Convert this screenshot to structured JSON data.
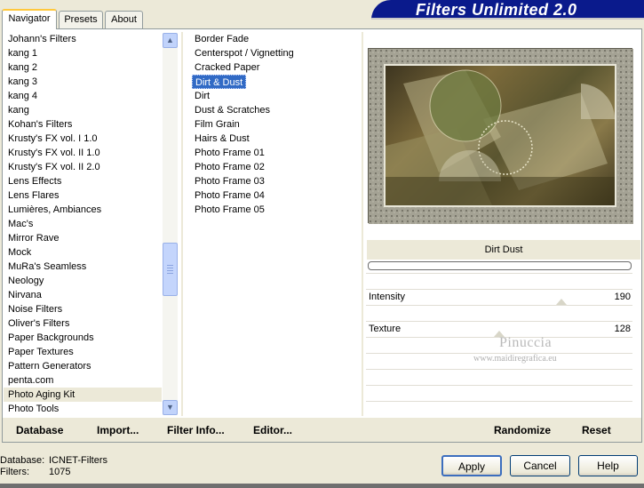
{
  "tabs": [
    {
      "label": "Navigator",
      "active": true
    },
    {
      "label": "Presets",
      "active": false
    },
    {
      "label": "About",
      "active": false
    }
  ],
  "banner": {
    "title": "Filters Unlimited 2.0"
  },
  "categories": [
    "Johann's Filters",
    "kang 1",
    "kang 2",
    "kang 3",
    "kang 4",
    "kang",
    "Kohan's Filters",
    "Krusty's FX vol. I 1.0",
    "Krusty's FX vol. II 1.0",
    "Krusty's FX vol. II 2.0",
    "Lens Effects",
    "Lens Flares",
    "Lumières, Ambiances",
    "Mac's",
    "Mirror Rave",
    "Mock",
    "MuRa's Seamless",
    "Neology",
    "Nirvana",
    "Noise Filters",
    "Oliver's Filters",
    "Paper Backgrounds",
    "Paper Textures",
    "Pattern Generators",
    "penta.com",
    "Photo Aging Kit",
    "Photo Tools"
  ],
  "highlighted_category": "Photo Aging Kit",
  "filters": [
    "Border Fade",
    "Centerspot / Vignetting",
    "Cracked Paper",
    "Dirt & Dust",
    "Dirt",
    "Dust & Scratches",
    "Film Grain",
    "Hairs & Dust",
    "Photo Frame 01",
    "Photo Frame 02",
    "Photo Frame 03",
    "Photo Frame 04",
    "Photo Frame 05"
  ],
  "selected_filter": "Dirt & Dust",
  "filter_title": "Dirt  Dust",
  "params": {
    "intensity": {
      "label": "Intensity",
      "value": "190"
    },
    "texture": {
      "label": "Texture",
      "value": "128"
    }
  },
  "watermark": {
    "line1": "Pinuccia",
    "line2": "www.maidiregrafica.eu"
  },
  "toolbar": {
    "database": "Database",
    "import": "Import...",
    "filter_info": "Filter Info...",
    "editor": "Editor...",
    "randomize": "Randomize",
    "reset": "Reset"
  },
  "status": {
    "database_label": "Database:",
    "database_value": "ICNET-Filters",
    "filters_label": "Filters:",
    "filters_value": "1075"
  },
  "buttons": {
    "apply": "Apply",
    "cancel": "Cancel",
    "help": "Help"
  },
  "icons": {
    "scroll_up": "▲",
    "scroll_down": "▼"
  }
}
